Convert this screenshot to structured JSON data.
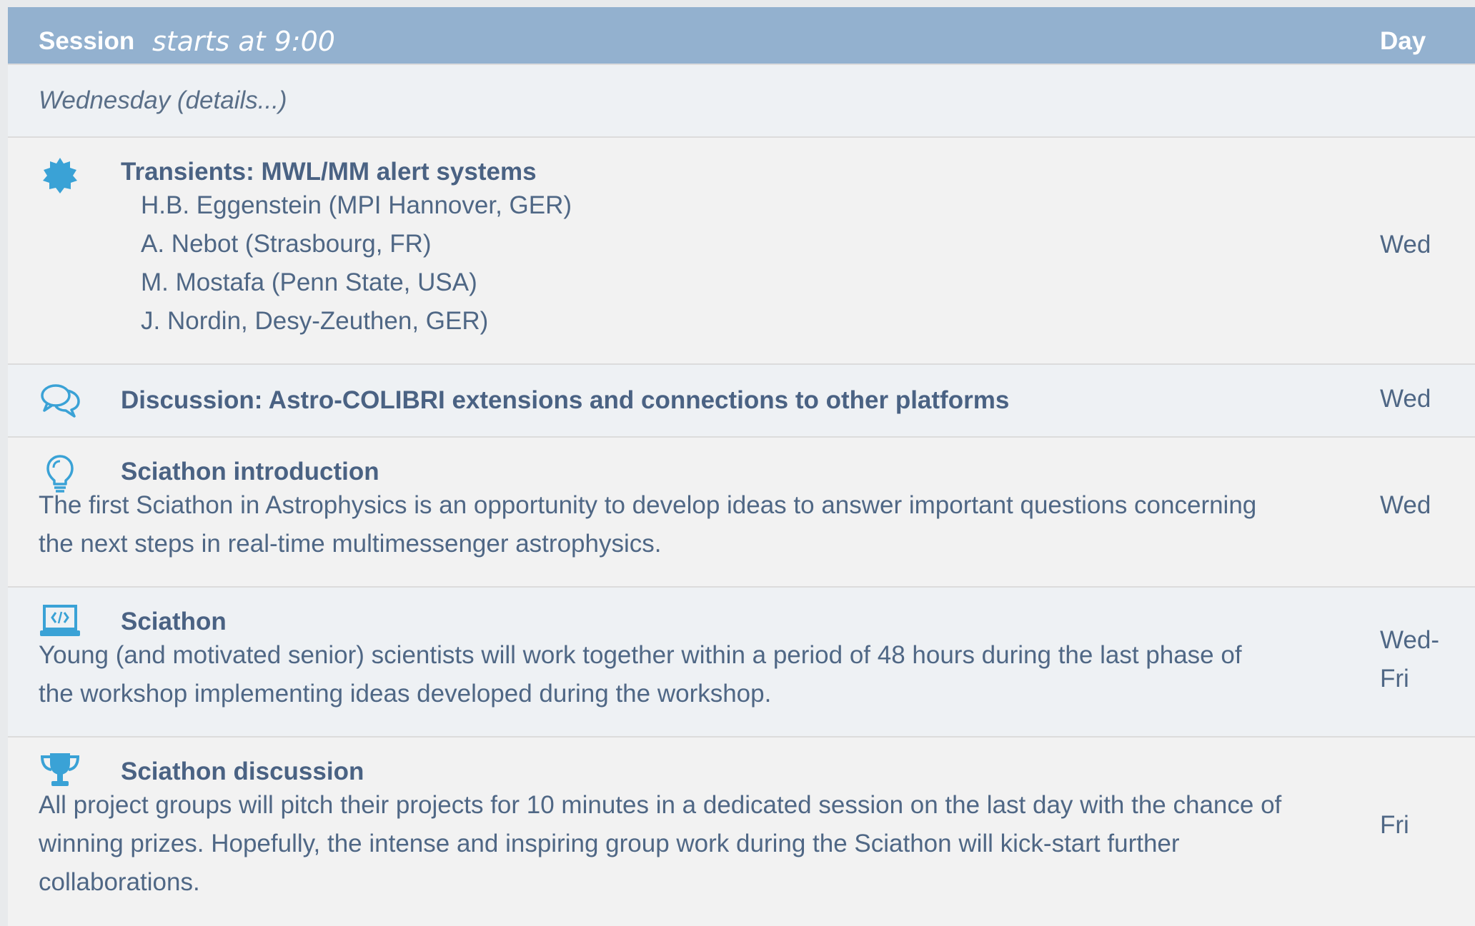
{
  "header": {
    "session_label": "Session",
    "starts_label": "starts at 9:00",
    "day_label": "Day"
  },
  "day_row": {
    "label": "Wednesday (details...)"
  },
  "rows": [
    {
      "icon": "badge-icon",
      "title": "Transients: MWL/MM alert systems",
      "speakers": [
        "H.B. Eggenstein (MPI Hannover, GER)",
        "A. Nebot (Strasbourg, FR)",
        "M. Mostafa (Penn State, USA)",
        "J. Nordin, Desy-Zeuthen, GER)"
      ],
      "day": "Wed"
    },
    {
      "icon": "chat-bubbles-icon",
      "title": "Discussion: Astro-COLIBRI extensions and connections to other platforms",
      "day": "Wed"
    },
    {
      "icon": "lightbulb-icon",
      "title": "Sciathon introduction",
      "description_lines": [
        "The first Sciathon in Astrophysics is an opportunity to develop ideas to answer important questions concerning",
        "the next steps in real-time multimessenger astrophysics."
      ],
      "day": "Wed"
    },
    {
      "icon": "laptop-code-icon",
      "title": "Sciathon",
      "description_lines": [
        "Young (and motivated senior) scientists will work together within a period of 48 hours during the last phase of",
        "the workshop implementing ideas developed during the workshop."
      ],
      "day_lines": [
        "Wed-",
        "Fri"
      ]
    },
    {
      "icon": "trophy-icon",
      "title": "Sciathon discussion",
      "description_lines": [
        "All project groups will pitch their projects for 10 minutes in a dedicated session on the last day with the chance of",
        "winning prizes. Hopefully, the intense and inspiring group work during the Sciathon will kick-start further",
        "collaborations."
      ],
      "day": "Fri"
    }
  ],
  "colors": {
    "header_bg": "#93b1cf",
    "icon_blue": "#3aa2d6",
    "text": "#4f6785"
  }
}
